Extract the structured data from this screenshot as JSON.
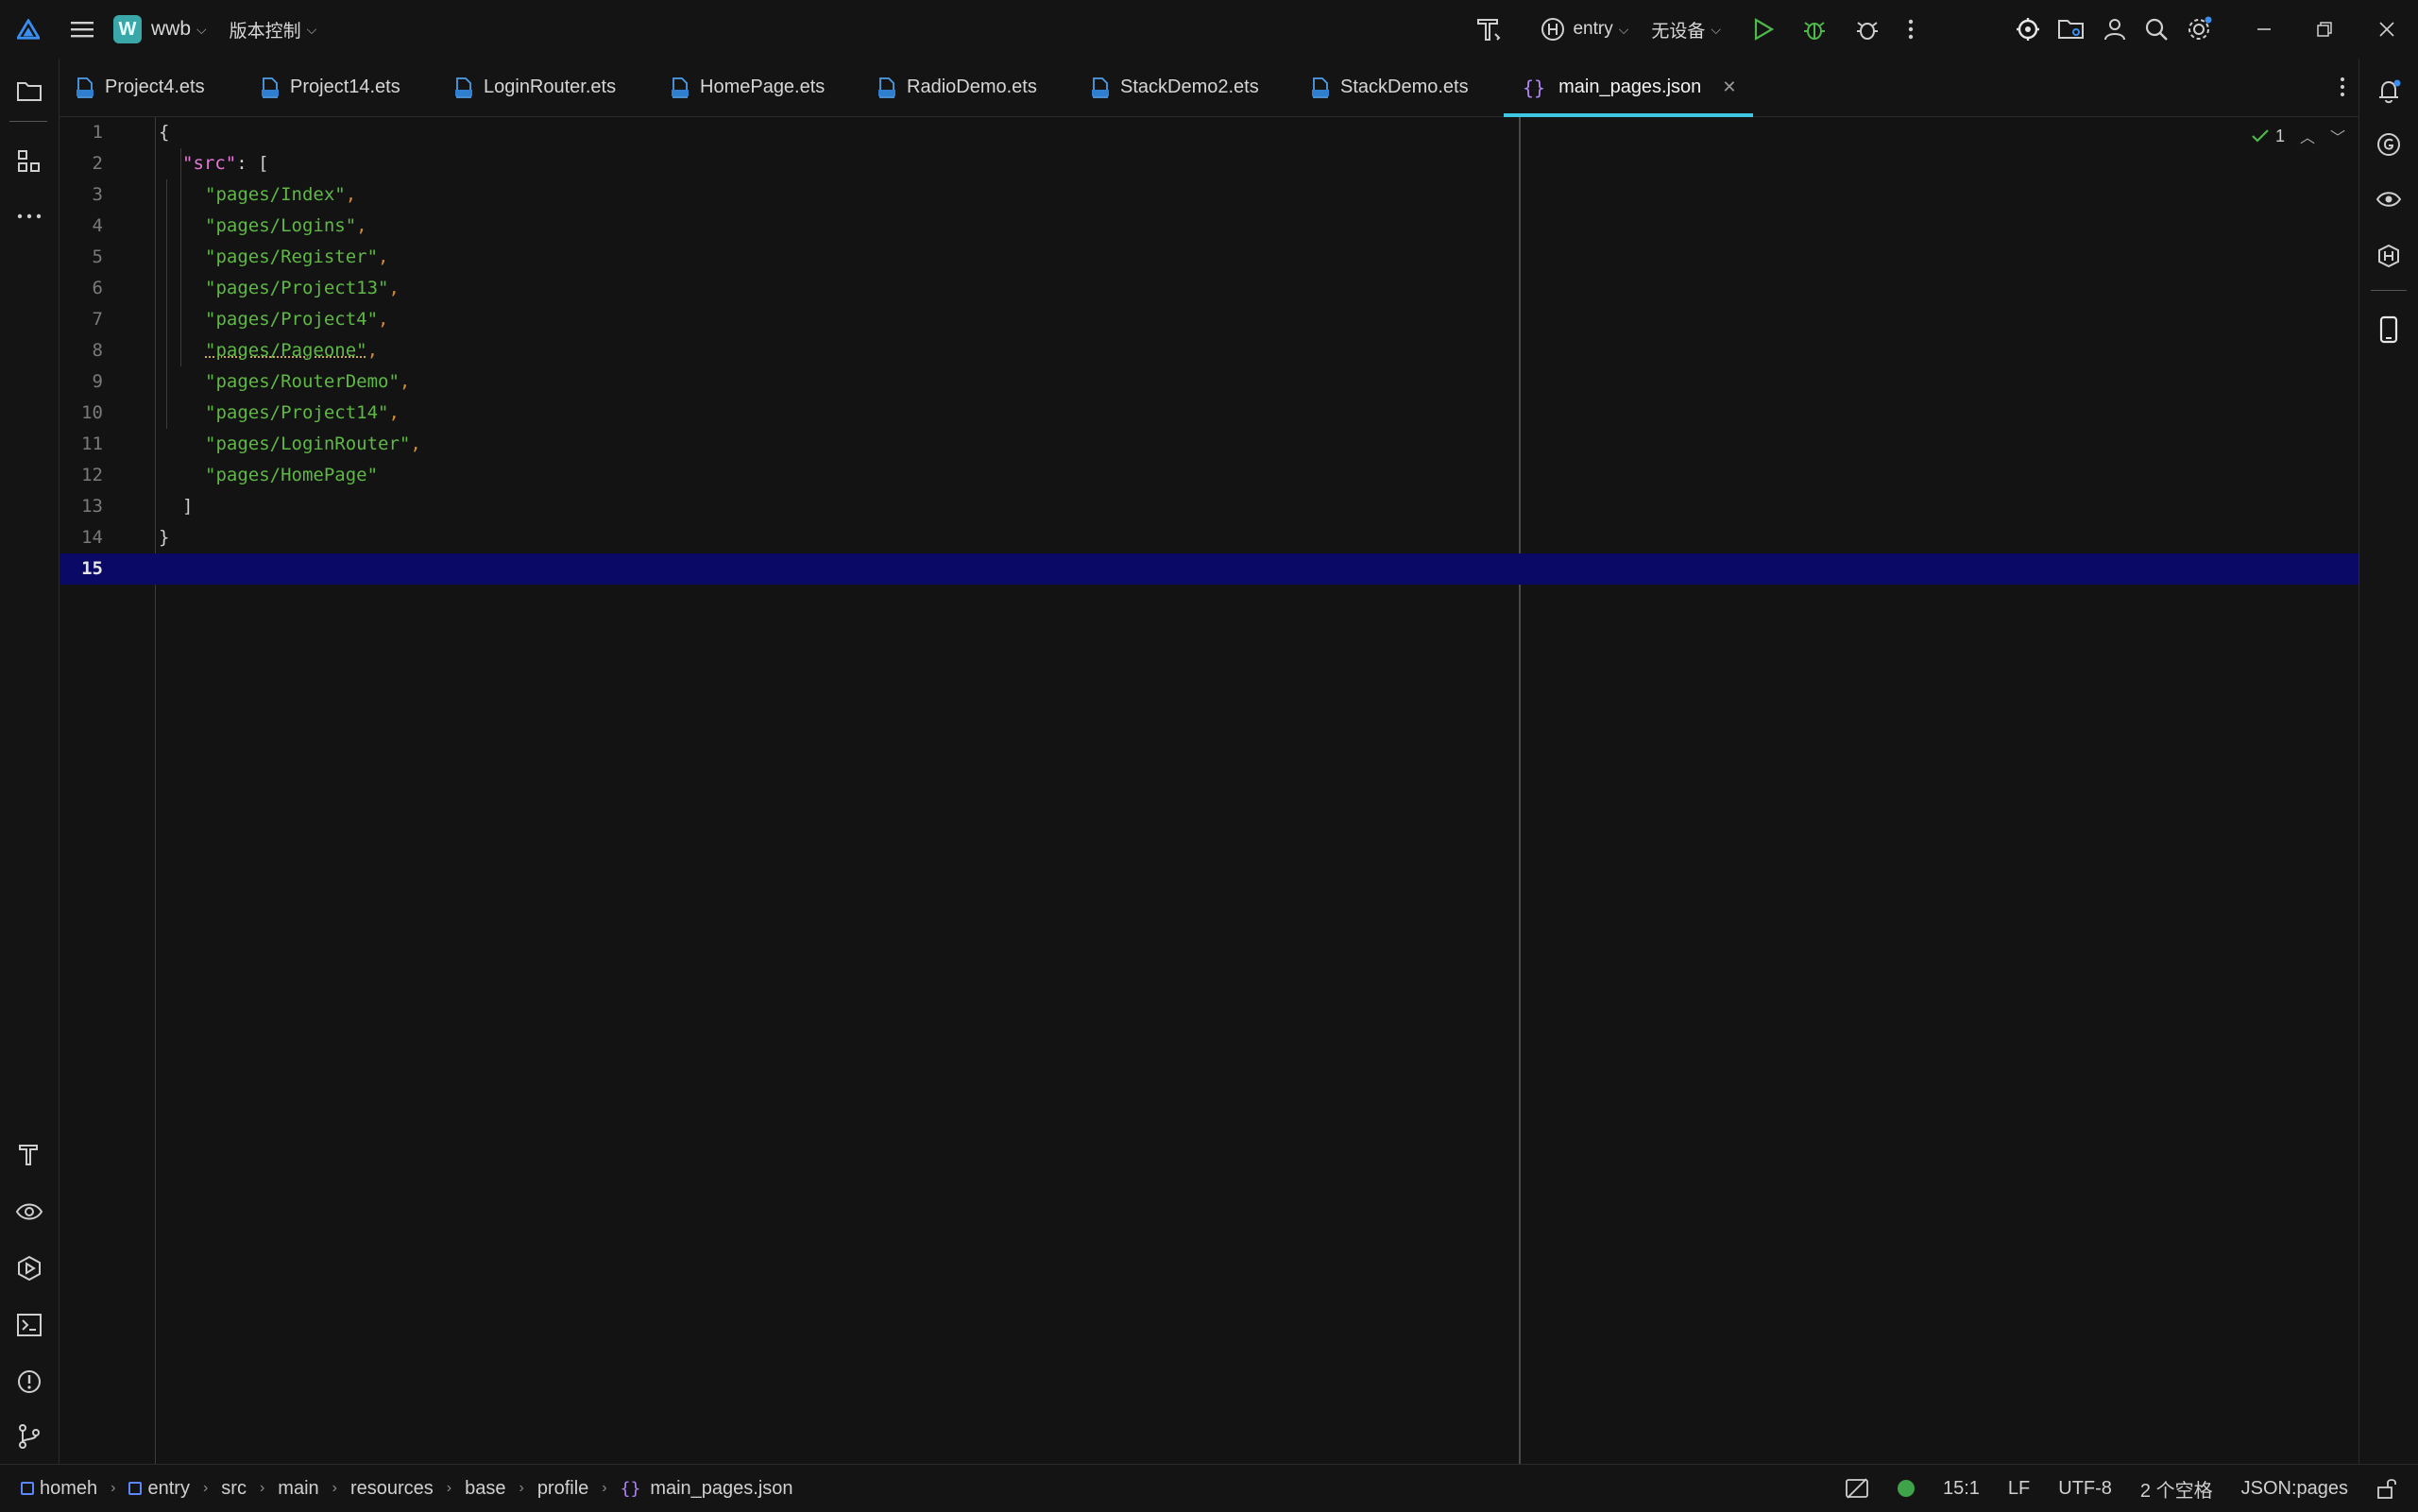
{
  "titlebar": {
    "project_letter": "W",
    "project_name": "wwb",
    "vcs_label": "版本控制",
    "module_label": "entry",
    "device_label": "无设备"
  },
  "tabs": [
    {
      "label": "Project4.ets",
      "type": "ets"
    },
    {
      "label": "Project14.ets",
      "type": "ets"
    },
    {
      "label": "LoginRouter.ets",
      "type": "ets"
    },
    {
      "label": "HomePage.ets",
      "type": "ets"
    },
    {
      "label": "RadioDemo.ets",
      "type": "ets"
    },
    {
      "label": "StackDemo2.ets",
      "type": "ets"
    },
    {
      "label": "StackDemo.ets",
      "type": "ets"
    },
    {
      "label": "main_pages.json",
      "type": "json",
      "active": true
    }
  ],
  "editor": {
    "line_numbers": [
      "1",
      "2",
      "3",
      "4",
      "5",
      "6",
      "7",
      "8",
      "9",
      "10",
      "11",
      "12",
      "13",
      "14",
      "15"
    ],
    "open_brace": "{",
    "src_key": "\"src\"",
    "colon_bracket": ": [",
    "pages": [
      "\"pages/Index\"",
      "\"pages/Logins\"",
      "\"pages/Register\"",
      "\"pages/Project13\"",
      "\"pages/Project4\"",
      "\"pages/Pageone\"",
      "\"pages/RouterDemo\"",
      "\"pages/Project14\"",
      "\"pages/LoginRouter\"",
      "\"pages/HomePage\""
    ],
    "comma": ",",
    "close_bracket": "]",
    "close_brace": "}",
    "inspection_count": "1"
  },
  "statusbar": {
    "breadcrumbs": [
      "homeh",
      "entry",
      "src",
      "main",
      "resources",
      "base",
      "profile",
      "main_pages.json"
    ],
    "position": "15:1",
    "line_sep": "LF",
    "encoding": "UTF-8",
    "indent": "2 个空格",
    "file_type": "JSON:pages"
  },
  "colors": {
    "accent": "#3fc6e2",
    "current_line": "#0a0a66",
    "string": "#5fb845",
    "key": "#e27ad6"
  }
}
